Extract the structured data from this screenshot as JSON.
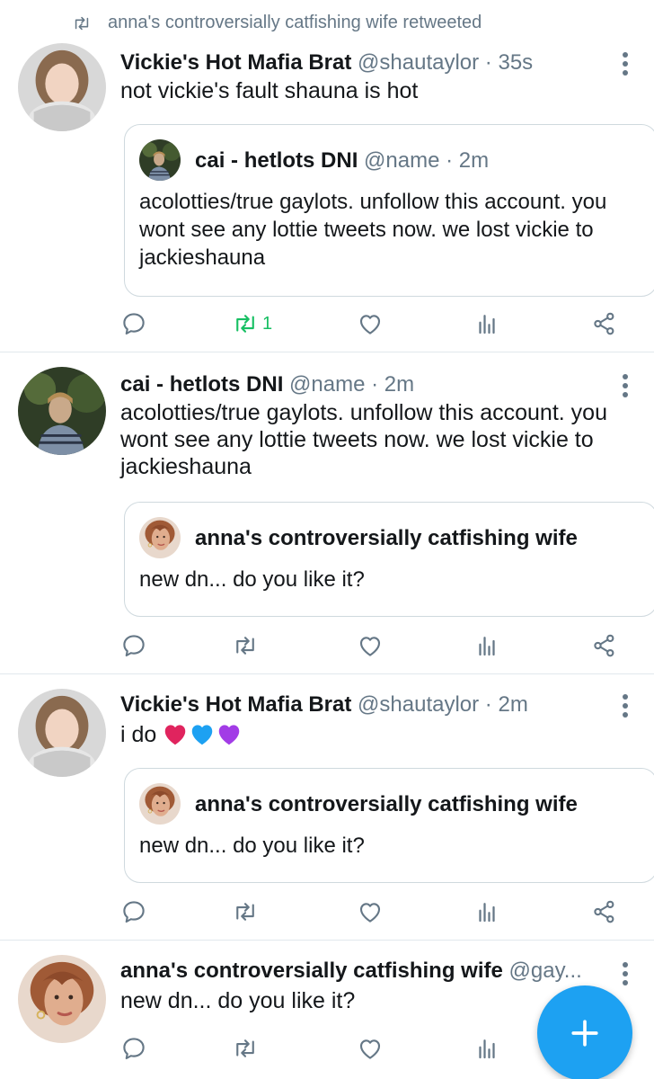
{
  "tweets": [
    {
      "retweet_banner": "anna's controversially catfishing wife retweeted",
      "name": "Vickie's Hot Mafia Brat",
      "handle": "@shautaylor",
      "dot": "·",
      "time": "35s",
      "text": "not vickie's fault shauna is hot",
      "quote": {
        "name": "cai - hetlots DNI",
        "handle": "@name",
        "dot": "·",
        "time": "2m",
        "text": "acolotties/true gaylots. unfollow this account. you wont see any lottie tweets now. we lost vickie to jackieshauna"
      },
      "retweet_count": "1"
    },
    {
      "name": "cai - hetlots DNI",
      "handle": "@name",
      "dot": "·",
      "time": "2m",
      "text": "acolotties/true gaylots. unfollow this account. you wont see any lottie tweets now. we lost vickie to jackieshauna",
      "quote": {
        "name": "anna's controversially catfishing wife",
        "text": "new dn... do you like it?"
      }
    },
    {
      "name": "Vickie's Hot Mafia Brat",
      "handle": "@shautaylor",
      "dot": "·",
      "time": "2m",
      "text": "i do",
      "hearts": [
        "#e0245e",
        "#1da1f2",
        "#a23ce6"
      ],
      "quote": {
        "name": "anna's controversially catfishing wife",
        "text": "new dn... do you like it?"
      }
    },
    {
      "name": "anna's controversially catfishing wife",
      "handle": "@gay...",
      "text": "new dn... do you like it?"
    }
  ],
  "colors": {
    "accent": "#1da1f2",
    "retweet_green": "#17bf63",
    "muted": "#657786"
  },
  "icons": {
    "reply": "reply-icon",
    "retweet": "retweet-icon",
    "like": "heart-icon",
    "analytics": "analytics-icon",
    "share": "share-icon",
    "more": "more-vertical-icon",
    "compose": "plus-icon"
  }
}
